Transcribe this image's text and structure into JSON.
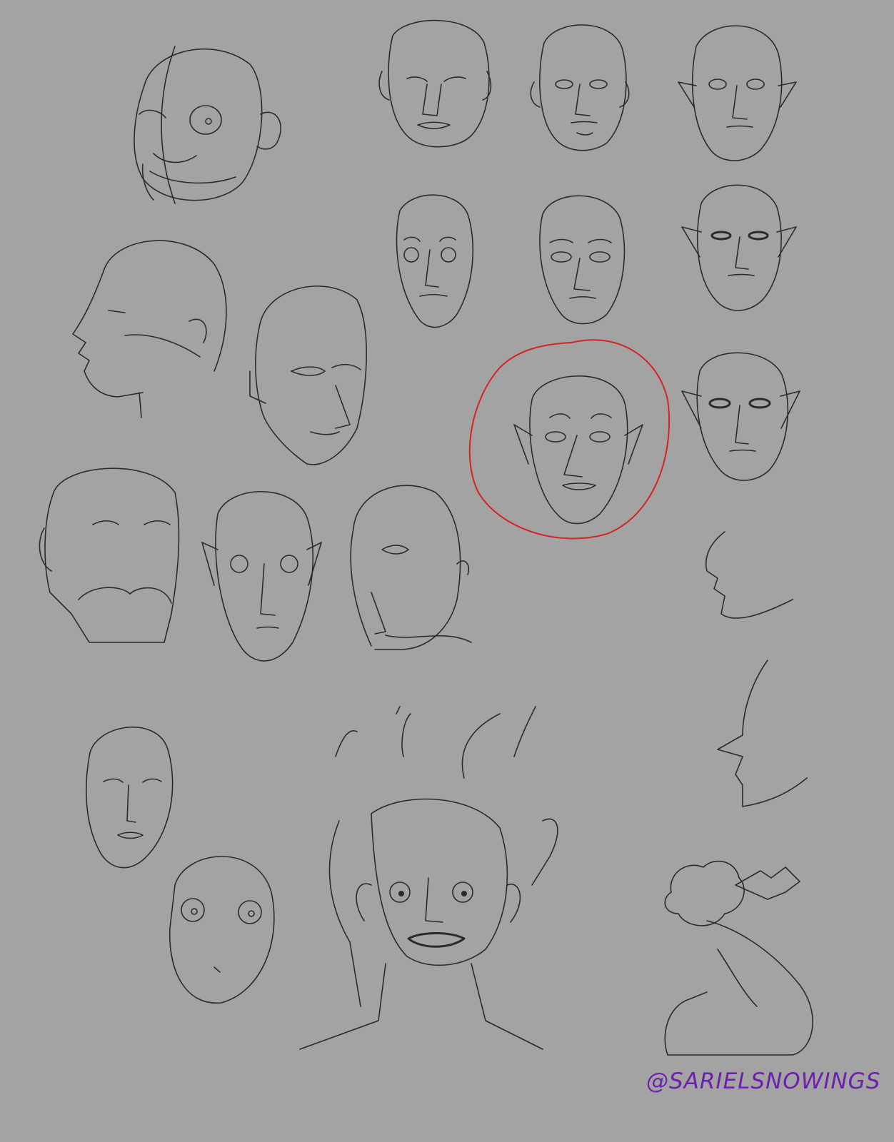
{
  "artwork": {
    "watermark": "@SARIELSNOWINGS",
    "background_color": "#a3a3a3",
    "ink_color": "#2b2b2b",
    "highlight_color": "#d42424",
    "watermark_color": "#6e1fae"
  }
}
